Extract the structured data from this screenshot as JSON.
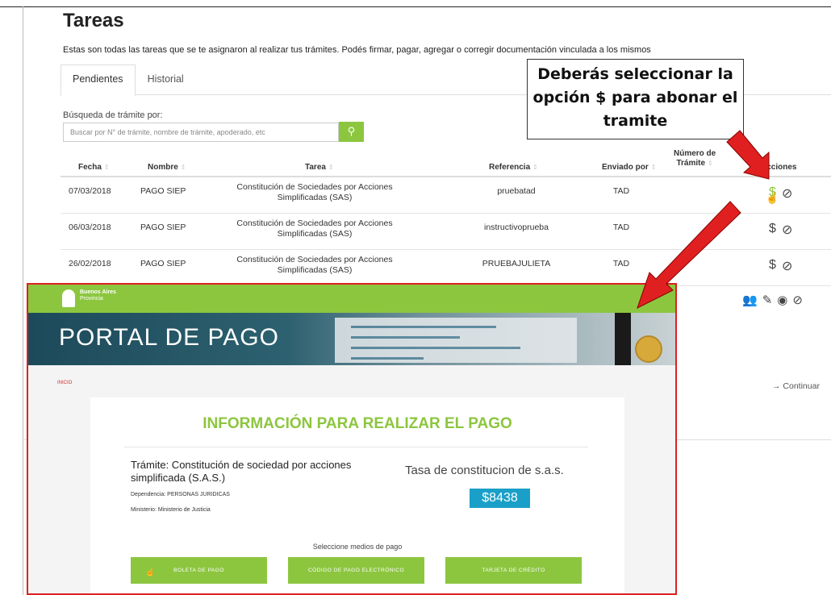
{
  "page": {
    "title": "Tareas",
    "intro": "Estas son todas las tareas que se te asignaron al realizar tus trámites. Podés firmar, pagar, agregar o corregir documentación vinculada a los mismos"
  },
  "tabs": [
    {
      "label": "Pendientes"
    },
    {
      "label": "Historial"
    }
  ],
  "search": {
    "label": "Búsqueda de trámite por:",
    "placeholder": "Buscar por N° de trámite, nombre de trámite, apoderado, etc",
    "button_icon": "search-icon"
  },
  "table": {
    "headers": {
      "fecha": "Fecha",
      "nombre": "Nombre",
      "tarea": "Tarea",
      "referencia": "Referencia",
      "enviado": "Enviado por",
      "numero_1": "Número de",
      "numero_2": "Trámite",
      "acciones": "Acciones"
    },
    "rows": [
      {
        "fecha": "07/03/2018",
        "nombre": "PAGO SIEP",
        "tarea_1": "Constitución de Sociedades por Acciones",
        "tarea_2": "Simplificadas (SAS)",
        "referencia": "pruebatad",
        "enviado": "TAD",
        "pay": "$",
        "cancel": "⊘"
      },
      {
        "fecha": "06/03/2018",
        "nombre": "PAGO SIEP",
        "tarea_1": "Constitución de Sociedades por Acciones",
        "tarea_2": "Simplificadas (SAS)",
        "referencia": "instructivoprueba",
        "enviado": "TAD",
        "pay": "$",
        "cancel": "⊘"
      },
      {
        "fecha": "26/02/2018",
        "nombre": "PAGO SIEP",
        "tarea_1": "Constitución de Sociedades por Acciones",
        "tarea_2": "Simplificadas (SAS)",
        "referencia": "PRUEBAJULIETA",
        "enviado": "TAD",
        "pay": "$",
        "cancel": "⊘"
      }
    ]
  },
  "continuar": "→ Continuar",
  "callout": {
    "line1": "Deberás seleccionar la",
    "line2": "opción $ para abonar el",
    "line3": "tramite"
  },
  "portal": {
    "logo_line1": "Buenos Aires",
    "logo_line2": "Provincia",
    "banner_title": "PORTAL DE PAGO",
    "crumb": "INICIO",
    "card_title": "INFORMACIÓN PARA REALIZAR EL PAGO",
    "tramite": "Trámite: Constitución de sociedad por acciones simplificada (S.A.S.)",
    "dependencia": "Dependencia: PERSONAS JURIDICAS",
    "ministerio": "Ministerio: Ministerio de Justicia",
    "tasa": "Tasa de constitucion de s.a.s.",
    "price": "$8438",
    "medios": "Seleccione medios de pago",
    "buttons": [
      "BOLETA DE PAGO",
      "CÓDIGO DE PAGO ELECTRÓNICO",
      "TARJETA DE CRÉDITO"
    ]
  },
  "colors": {
    "accent_green": "#8cc63f",
    "arrow_red": "#e02020",
    "price_blue": "#1aa0c8"
  }
}
